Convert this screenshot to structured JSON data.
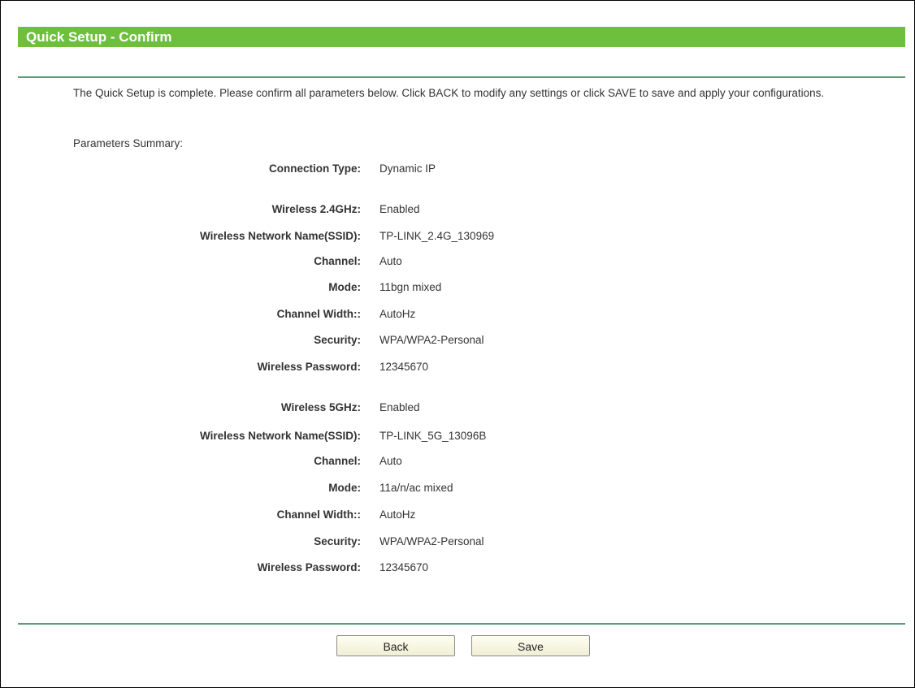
{
  "page": {
    "title": "Quick Setup - Confirm",
    "intro": "The Quick Setup is complete. Please confirm all parameters below. Click BACK to modify any settings or click SAVE to save and apply your configurations.",
    "summary_label": "Parameters Summary:"
  },
  "params": [
    {
      "label": "Connection Type:",
      "value": "Dynamic IP"
    },
    {
      "label": "Wireless 2.4GHz:",
      "value": "Enabled"
    },
    {
      "label": "Wireless Network Name(SSID):",
      "value": "TP-LINK_2.4G_130969"
    },
    {
      "label": "Channel:",
      "value": "Auto"
    },
    {
      "label": "Mode:",
      "value": "11bgn mixed"
    },
    {
      "label": "Channel Width::",
      "value": "AutoHz"
    },
    {
      "label": "Security:",
      "value": "WPA/WPA2-Personal"
    },
    {
      "label": "Wireless Password:",
      "value": "12345670"
    },
    {
      "label": "Wireless 5GHz:",
      "value": "Enabled"
    },
    {
      "label": "Wireless Network Name(SSID):",
      "value": "TP-LINK_5G_13096B"
    },
    {
      "label": "Channel:",
      "value": "Auto"
    },
    {
      "label": "Mode:",
      "value": "11a/n/ac mixed"
    },
    {
      "label": "Channel Width::",
      "value": "AutoHz"
    },
    {
      "label": "Security:",
      "value": "WPA/WPA2-Personal"
    },
    {
      "label": "Wireless Password:",
      "value": "12345670"
    }
  ],
  "buttons": {
    "back": "Back",
    "save": "Save"
  },
  "colors": {
    "title_bar": "#6dbf3c",
    "rule": "#5c9d79"
  }
}
